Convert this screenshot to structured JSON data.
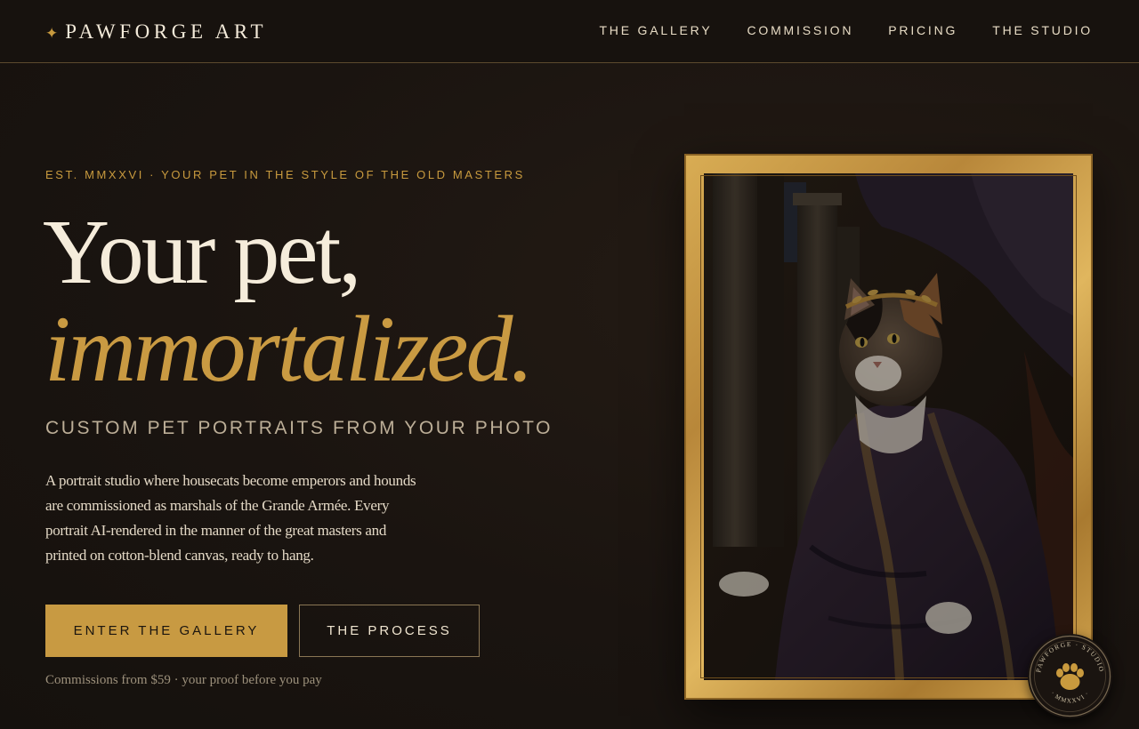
{
  "header": {
    "logo": {
      "star": "✦",
      "text": "PAWFORGE ART"
    },
    "nav": [
      {
        "label": "THE GALLERY"
      },
      {
        "label": "COMMISSION"
      },
      {
        "label": "PRICING"
      },
      {
        "label": "THE STUDIO"
      }
    ]
  },
  "hero": {
    "eyebrow": "EST. MMXXVI · YOUR PET IN THE STYLE OF THE OLD MASTERS",
    "headline_line1": "Your pet,",
    "headline_line2": "immortalized.",
    "subhead": "CUSTOM PET PORTRAITS FROM YOUR PHOTO",
    "body": "A portrait studio where housecats become emperors and hounds are commissioned as marshals of the Grande Armée. Every portrait AI-rendered in the manner of the great masters and printed on cotton-blend canvas, ready to hang.",
    "primary_button": "ENTER THE GALLERY",
    "secondary_button": "THE PROCESS",
    "footnote": "Commissions from $59 · your proof before you pay"
  },
  "seal": {
    "text_top": "PAWFORGE · STUDIO",
    "text_bottom": "· MMXXVI ·",
    "icon": "paw-icon"
  },
  "colors": {
    "background": "#1a1410",
    "gold": "#c89a42",
    "cream": "#f5ecdb",
    "muted": "#bcae97"
  }
}
